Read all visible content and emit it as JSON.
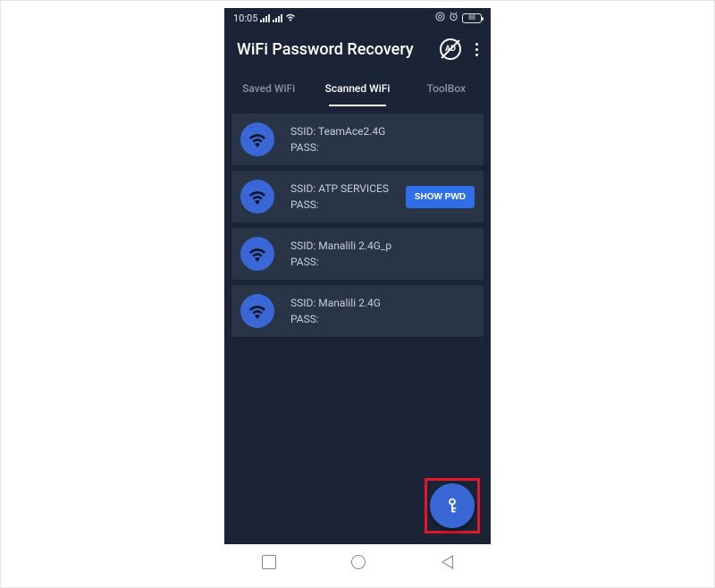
{
  "status": {
    "time": "10:05",
    "battery": "88"
  },
  "header": {
    "title": "WiFi Password Recovery",
    "ad_label": "AD"
  },
  "tabs": {
    "saved": "Saved WiFi",
    "scanned": "Scanned WiFi",
    "toolbox": "ToolBox"
  },
  "labels": {
    "ssid": "SSID:",
    "pass": "PASS:",
    "show_pwd": "SHOW PWD"
  },
  "networks": [
    {
      "ssid": "TeamAce2.4G",
      "pass": "",
      "show_button": false
    },
    {
      "ssid": "ATP SERVICES",
      "pass": "",
      "show_button": true
    },
    {
      "ssid": "Manalili 2.4G_p",
      "pass": "",
      "show_button": false
    },
    {
      "ssid": "Manalili 2.4G",
      "pass": "",
      "show_button": false
    }
  ]
}
